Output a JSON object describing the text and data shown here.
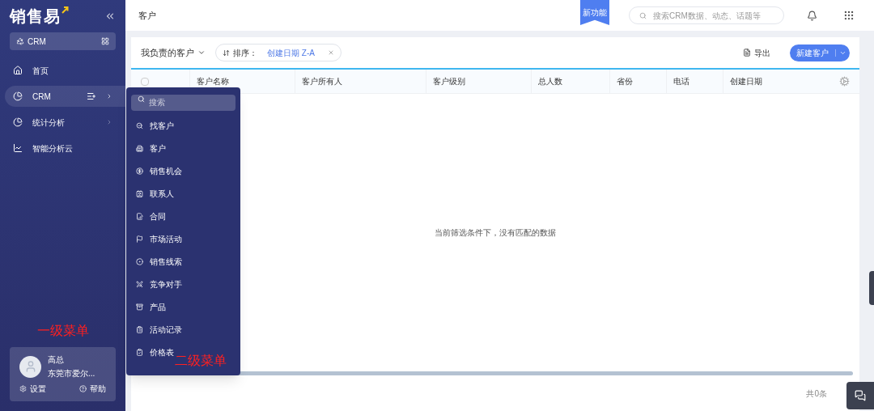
{
  "sidebar": {
    "logo": "销售易",
    "app_switcher": "CRM",
    "items": [
      {
        "label": "首页",
        "selected": false,
        "has_submenu": false
      },
      {
        "label": "CRM",
        "selected": true,
        "has_submenu": true
      },
      {
        "label": "统计分析",
        "selected": false,
        "has_submenu": true
      },
      {
        "label": "智能分析云",
        "selected": false,
        "has_submenu": false
      }
    ],
    "user": {
      "name": "高总",
      "company": "东莞市爱尔...",
      "settings": "设置",
      "help": "帮助"
    }
  },
  "submenu": {
    "search_placeholder": "搜索",
    "items": [
      "找客户",
      "客户",
      "销售机会",
      "联系人",
      "合同",
      "市场活动",
      "销售线索",
      "竞争对手",
      "产品",
      "活动记录",
      "价格表"
    ]
  },
  "annotations": [
    "一级菜单",
    "二级菜单"
  ],
  "topbar": {
    "title": "客户",
    "new_feature_badge": "新功能",
    "search_placeholder": "搜索CRM数据、动态、话题等"
  },
  "list": {
    "view": "我负责的客户",
    "sort_label": "排序：",
    "sort_value": "创建日期 Z-A",
    "export": "导出",
    "new_button": "新建客户",
    "select_all_checked": false,
    "columns": [
      "客户名称",
      "客户所有人",
      "客户级别",
      "总人数",
      "省份",
      "电话",
      "创建日期"
    ],
    "empty_message": "当前筛选条件下，没有匹配的数据",
    "total": "共0条"
  }
}
